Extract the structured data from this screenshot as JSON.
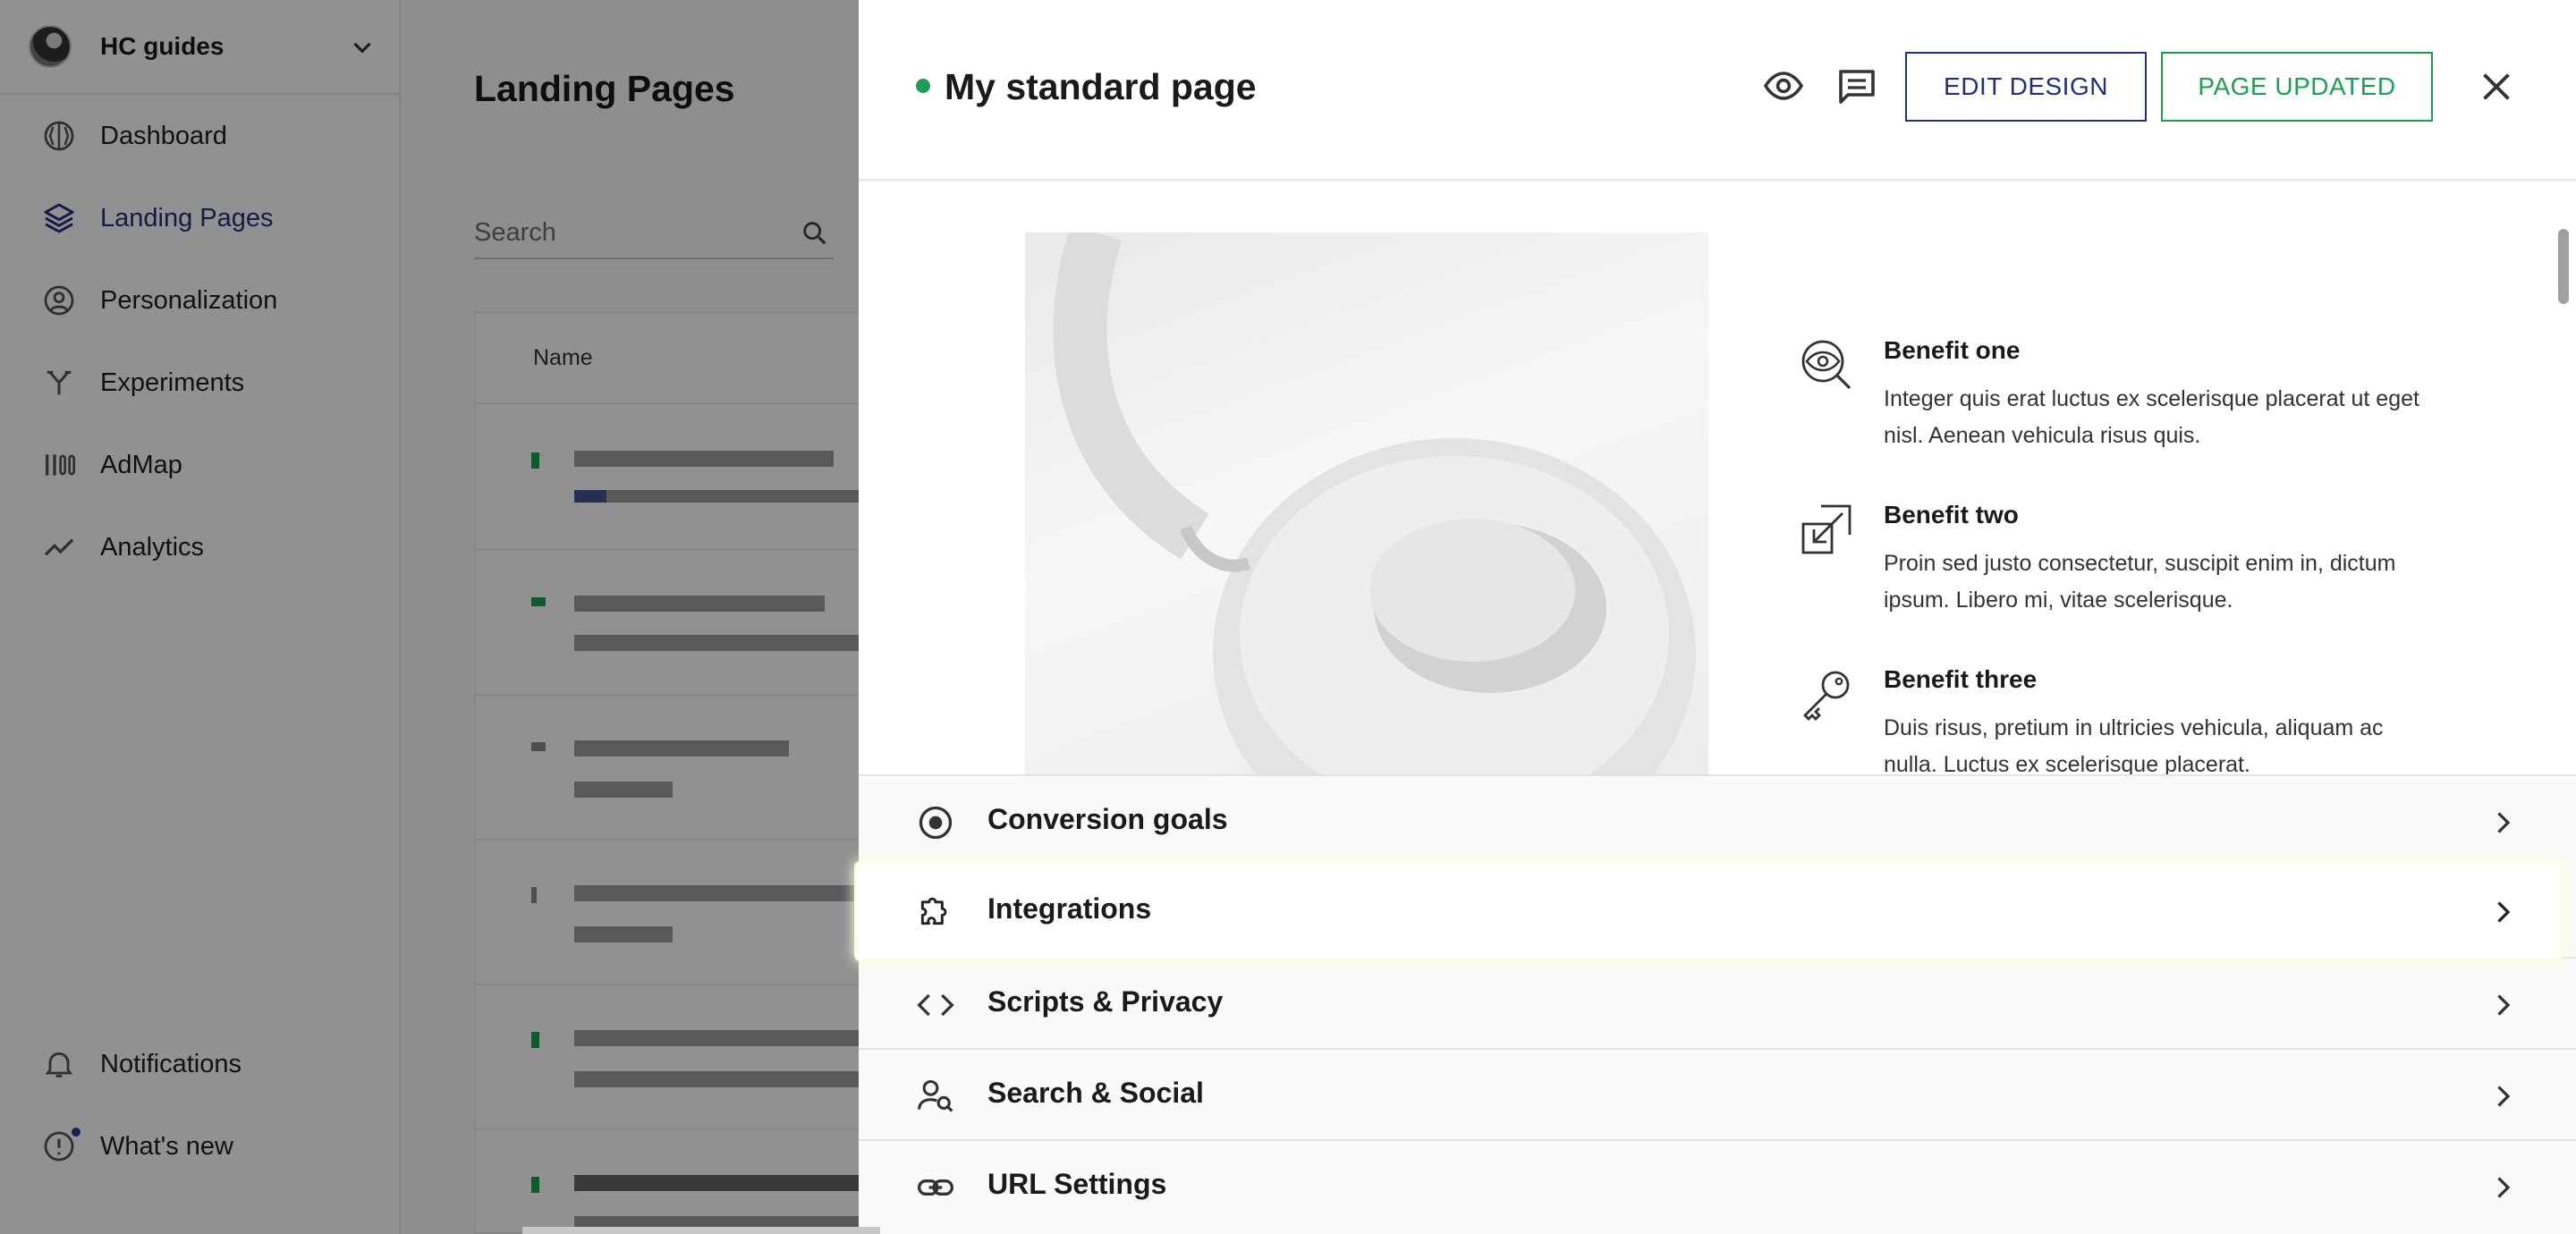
{
  "sidebar": {
    "workspace": "HC guides",
    "items": [
      {
        "label": "Dashboard",
        "icon": "dashboard-icon"
      },
      {
        "label": "Landing Pages",
        "icon": "layers-icon",
        "active": true
      },
      {
        "label": "Personalization",
        "icon": "person-circle-icon"
      },
      {
        "label": "Experiments",
        "icon": "split-icon"
      },
      {
        "label": "AdMap",
        "icon": "admap-icon"
      },
      {
        "label": "Analytics",
        "icon": "trend-icon"
      }
    ],
    "bottom_items": [
      {
        "label": "Notifications",
        "icon": "bell-icon"
      },
      {
        "label": "What's new",
        "icon": "info-icon"
      }
    ]
  },
  "list": {
    "title": "Landing Pages",
    "search_placeholder": "Search",
    "column_name": "Name"
  },
  "panel": {
    "title": "My standard page",
    "status_color": "#1e9e55",
    "edit_design": "EDIT DESIGN",
    "page_updated": "PAGE UPDATED",
    "benefits": [
      {
        "title": "Benefit one",
        "text": "Integer quis erat luctus ex scelerisque placerat ut eget nisl. Aenean vehicula risus quis."
      },
      {
        "title": "Benefit two",
        "text": "Proin sed justo consectetur, suscipit enim in, dictum ipsum. Libero mi, vitae scelerisque."
      },
      {
        "title": "Benefit three",
        "text": "Duis risus, pretium in ultricies vehicula, aliquam ac nulla. Luctus ex scelerisque placerat."
      }
    ],
    "sections": [
      {
        "label": "Conversion goals",
        "icon": "target-icon"
      },
      {
        "label": "Integrations",
        "icon": "puzzle-icon",
        "highlighted": true
      },
      {
        "label": "Scripts & Privacy",
        "icon": "code-icon"
      },
      {
        "label": "Search & Social",
        "icon": "person-search-icon"
      },
      {
        "label": "URL Settings",
        "icon": "link-icon"
      }
    ]
  },
  "colors": {
    "accent": "#22307a",
    "success": "#1e9e55"
  }
}
